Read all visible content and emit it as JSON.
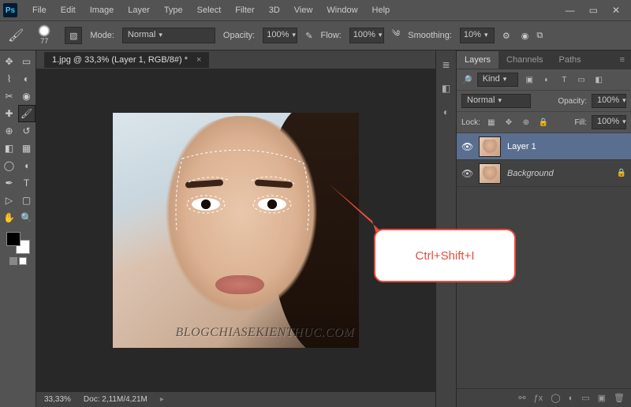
{
  "menu": [
    "File",
    "Edit",
    "Image",
    "Layer",
    "Type",
    "Select",
    "Filter",
    "3D",
    "View",
    "Window",
    "Help"
  ],
  "options": {
    "brush_size": "77",
    "mode_label": "Mode:",
    "mode_value": "Normal",
    "opacity_label": "Opacity:",
    "opacity_value": "100%",
    "flow_label": "Flow:",
    "flow_value": "100%",
    "smoothing_label": "Smoothing:",
    "smoothing_value": "10%"
  },
  "document": {
    "tab_title": "1.jpg @ 33,3% (Layer 1, RGB/8#) *",
    "zoom": "33,33%",
    "doc_label": "Doc:",
    "doc_size": "2,11M/4,21M",
    "watermark": "BLOGCHIASEKIENTHUC.COM"
  },
  "panels": {
    "tabs": [
      "Layers",
      "Channels",
      "Paths"
    ],
    "filter_label": "Kind",
    "blend_mode": "Normal",
    "opacity_label": "Opacity:",
    "opacity_value": "100%",
    "lock_label": "Lock:",
    "fill_label": "Fill:",
    "fill_value": "100%",
    "layers": [
      {
        "name": "Layer 1",
        "active": true,
        "locked": false,
        "italic": false
      },
      {
        "name": "Background",
        "active": false,
        "locked": true,
        "italic": true
      }
    ]
  },
  "callout": {
    "text": "Ctrl+Shift+I"
  }
}
